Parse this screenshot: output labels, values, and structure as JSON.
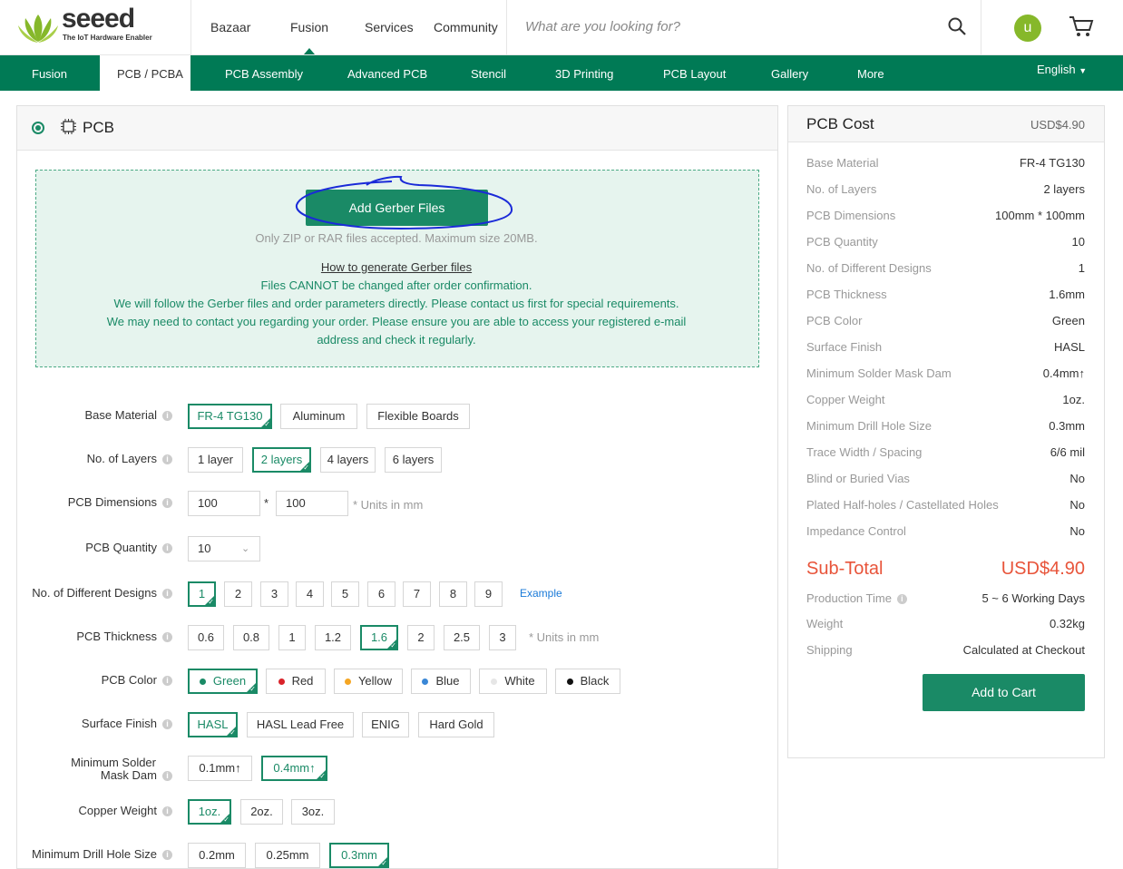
{
  "brand": {
    "name": "seeed",
    "tagline": "The IoT Hardware Enabler"
  },
  "topnav": [
    "Bazaar",
    "Fusion",
    "Services",
    "Community"
  ],
  "search": {
    "placeholder": "What are you looking for?"
  },
  "user": {
    "avatar_letter": "u"
  },
  "subnav": [
    "Fusion",
    "PCB / PCBA",
    "PCB Assembly",
    "Advanced PCB",
    "Stencil",
    "3D Printing",
    "PCB Layout",
    "Gallery",
    "More"
  ],
  "language": "English",
  "section": {
    "title": "PCB"
  },
  "upload": {
    "button": "Add Gerber Files",
    "accepted": "Only ZIP or RAR files accepted. Maximum size 20MB.",
    "howto": "How to generate Gerber files",
    "line1": "Files CANNOT be changed after order confirmation.",
    "line2": "We will follow the Gerber files and order parameters directly. Please contact us first for special requirements.",
    "line3": "We may need to contact you regarding your order. Please ensure you are able to access your registered e-mail",
    "line4": "address and check it regularly."
  },
  "form": {
    "base_material": {
      "label": "Base Material",
      "options": [
        "FR-4 TG130",
        "Aluminum",
        "Flexible Boards"
      ],
      "selected": "FR-4 TG130"
    },
    "layers": {
      "label": "No. of Layers",
      "options": [
        "1 layer",
        "2 layers",
        "4 layers",
        "6 layers"
      ],
      "selected": "2 layers"
    },
    "dimensions": {
      "label": "PCB Dimensions",
      "width": "100",
      "height": "100",
      "sep": "*",
      "unit": "* Units in mm"
    },
    "quantity": {
      "label": "PCB Quantity",
      "value": "10"
    },
    "designs": {
      "label": "No. of Different Designs",
      "options": [
        "1",
        "2",
        "3",
        "4",
        "5",
        "6",
        "7",
        "8",
        "9"
      ],
      "selected": "1",
      "example": "Example"
    },
    "thickness": {
      "label": "PCB Thickness",
      "options": [
        "0.6",
        "0.8",
        "1",
        "1.2",
        "1.6",
        "2",
        "2.5",
        "3"
      ],
      "selected": "1.6",
      "unit": "* Units in mm"
    },
    "color": {
      "label": "PCB Color",
      "options": [
        "Green",
        "Red",
        "Yellow",
        "Blue",
        "White",
        "Black"
      ],
      "swatches": [
        "#1a8a66",
        "#d9232a",
        "#f5a623",
        "#3a87d6",
        "#e6e6e6",
        "#111111"
      ],
      "selected": "Green"
    },
    "finish": {
      "label": "Surface Finish",
      "options": [
        "HASL",
        "HASL Lead Free",
        "ENIG",
        "Hard Gold"
      ],
      "selected": "HASL"
    },
    "mask_dam": {
      "label1": "Minimum Solder",
      "label2": "Mask Dam",
      "options": [
        "0.1mm↑",
        "0.4mm↑"
      ],
      "selected": "0.4mm↑"
    },
    "copper": {
      "label": "Copper Weight",
      "options": [
        "1oz.",
        "2oz.",
        "3oz."
      ],
      "selected": "1oz."
    },
    "drill": {
      "label": "Minimum Drill Hole Size",
      "options": [
        "0.2mm",
        "0.25mm",
        "0.3mm"
      ],
      "selected": "0.3mm"
    }
  },
  "cost": {
    "title": "PCB Cost",
    "price": "USD$4.90",
    "rows": [
      {
        "k": "Base Material",
        "v": "FR-4 TG130"
      },
      {
        "k": "No. of Layers",
        "v": "2 layers"
      },
      {
        "k": "PCB Dimensions",
        "v": "100mm * 100mm"
      },
      {
        "k": "PCB Quantity",
        "v": "10"
      },
      {
        "k": "No. of Different Designs",
        "v": "1"
      },
      {
        "k": "PCB Thickness",
        "v": "1.6mm"
      },
      {
        "k": "PCB Color",
        "v": "Green"
      },
      {
        "k": "Surface Finish",
        "v": "HASL"
      },
      {
        "k": "Minimum Solder Mask Dam",
        "v": "0.4mm↑"
      },
      {
        "k": "Copper Weight",
        "v": "1oz."
      },
      {
        "k": "Minimum Drill Hole Size",
        "v": "0.3mm"
      },
      {
        "k": "Trace Width / Spacing",
        "v": "6/6 mil"
      },
      {
        "k": "Blind or Buried Vias",
        "v": "No"
      },
      {
        "k": "Plated Half-holes / Castellated Holes",
        "v": "No"
      },
      {
        "k": "Impedance Control",
        "v": "No"
      }
    ],
    "subtotal_label": "Sub-Total",
    "subtotal": "USD$4.90",
    "production_label": "Production Time",
    "production": "5 ~ 6 Working Days",
    "weight_label": "Weight",
    "weight": "0.32kg",
    "shipping_label": "Shipping",
    "shipping": "Calculated at Checkout",
    "add_to_cart": "Add to Cart"
  }
}
